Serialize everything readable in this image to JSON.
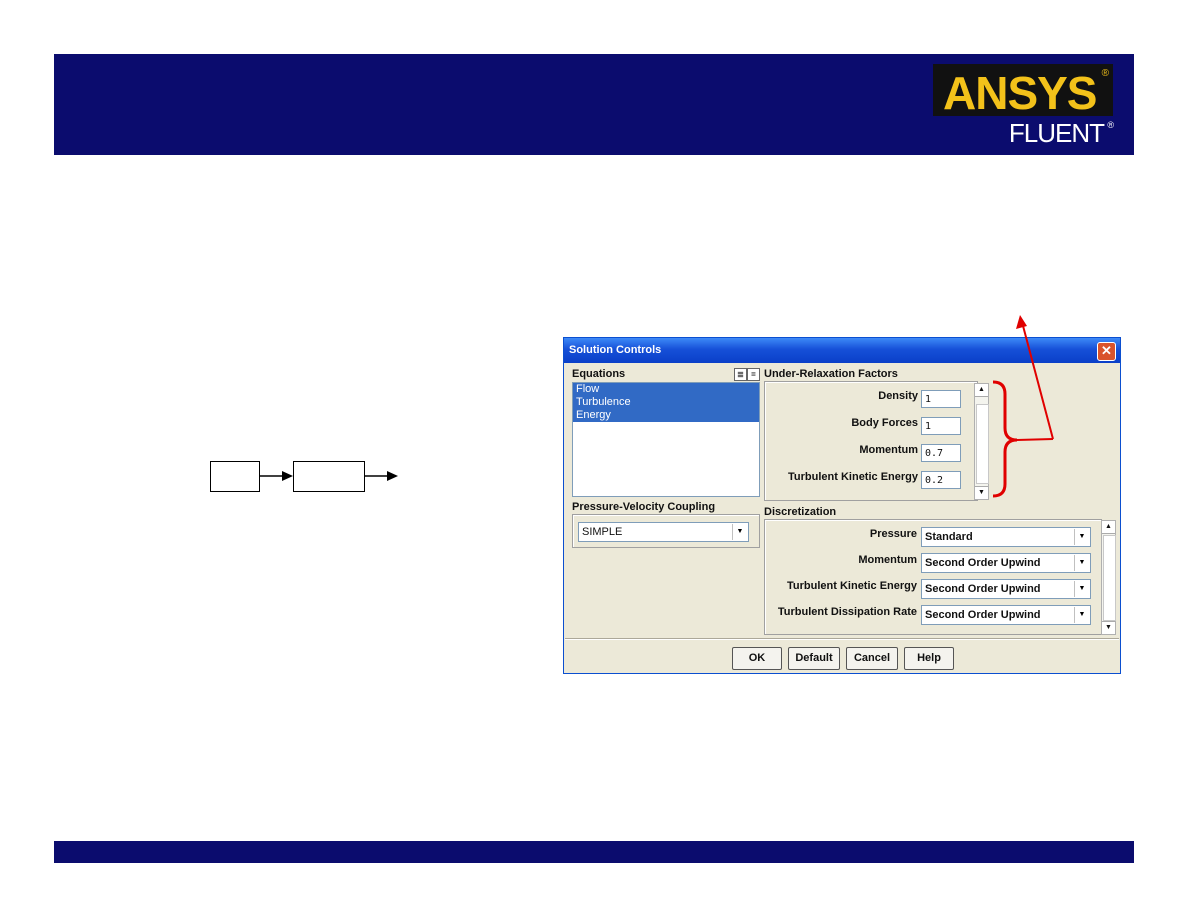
{
  "slide": {
    "banner_color": "#0b0c6e",
    "logo": {
      "brand": "ANSYS",
      "product": "FLUENT",
      "reg_mark": "®"
    }
  },
  "dialog": {
    "title": "Solution Controls",
    "equations": {
      "label": "Equations",
      "items": [
        "Flow",
        "Turbulence",
        "Energy"
      ]
    },
    "pvc": {
      "label": "Pressure-Velocity Coupling",
      "value": "SIMPLE"
    },
    "urf": {
      "label": "Under-Relaxation Factors",
      "rows": [
        {
          "label": "Density",
          "value": "1"
        },
        {
          "label": "Body Forces",
          "value": "1"
        },
        {
          "label": "Momentum",
          "value": "0.7"
        },
        {
          "label": "Turbulent Kinetic Energy",
          "value": "0.2"
        }
      ]
    },
    "discretization": {
      "label": "Discretization",
      "rows": [
        {
          "label": "Pressure",
          "value": "Standard"
        },
        {
          "label": "Momentum",
          "value": "Second Order Upwind"
        },
        {
          "label": "Turbulent Kinetic Energy",
          "value": "Second Order Upwind"
        },
        {
          "label": "Turbulent Dissipation Rate",
          "value": "Second Order Upwind"
        }
      ]
    },
    "buttons": {
      "ok": "OK",
      "default": "Default",
      "cancel": "Cancel",
      "help": "Help"
    }
  },
  "annotation": {
    "color": "#e00000"
  }
}
